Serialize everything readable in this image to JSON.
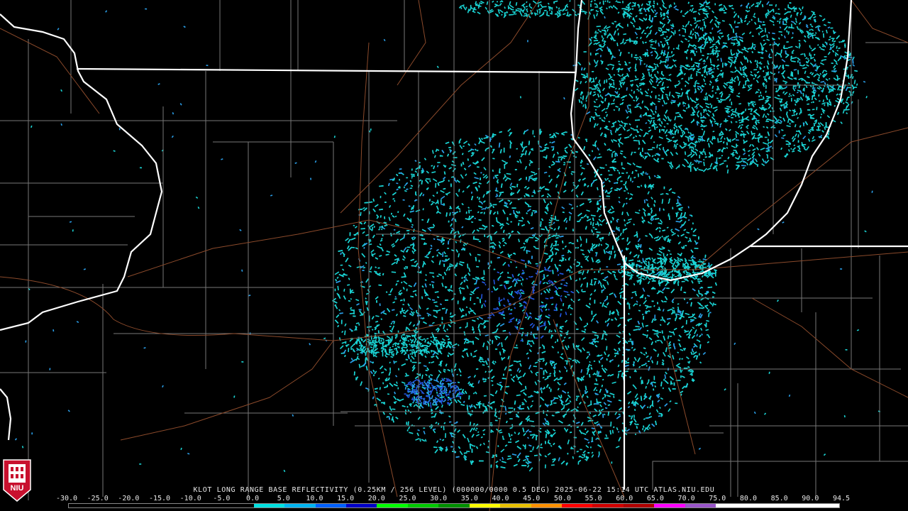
{
  "product": {
    "title": "KLOT LONG RANGE BASE REFLECTIVITY (0.25KM / 256 LEVEL) (000000/0000 0.5 DEG) 2025-06-22 15:14 UTC  ATLAS.NIU.EDU"
  },
  "legend": {
    "ticks": [
      "-30.0",
      "-25.0",
      "-20.0",
      "-15.0",
      "-10.0",
      "-5.0",
      "0.0",
      "5.0",
      "10.0",
      "15.0",
      "20.0",
      "25.0",
      "30.0",
      "35.0",
      "40.0",
      "45.0",
      "50.0",
      "55.0",
      "60.0",
      "65.0",
      "70.0",
      "75.0",
      "80.0",
      "85.0",
      "90.0",
      "94.5"
    ],
    "min": -30.0,
    "max": 94.5,
    "colors": [
      "#000000",
      "#000000",
      "#000000",
      "#000000",
      "#000000",
      "#000000",
      "#00e0e0",
      "#00b4f0",
      "#0060ff",
      "#0000c8",
      "#00ff00",
      "#00c800",
      "#009000",
      "#ffff00",
      "#e8c000",
      "#ff9000",
      "#ff0000",
      "#d00000",
      "#b00000",
      "#ff00ff",
      "#9955c9",
      "#ffffff",
      "#ffffff",
      "#ffffff",
      "#ffffff"
    ]
  },
  "logo": {
    "text": "NIU",
    "brand_color": "#c8102e"
  },
  "colors": {
    "background": "#000000",
    "state_border": "#ffffff",
    "county_border": "#777777",
    "road": "#8b4a2b",
    "echo_light": "#1ad4d4",
    "echo_mid": "#2a9ee8",
    "echo_dark": "#2255dd",
    "radar_site": "#000000"
  }
}
